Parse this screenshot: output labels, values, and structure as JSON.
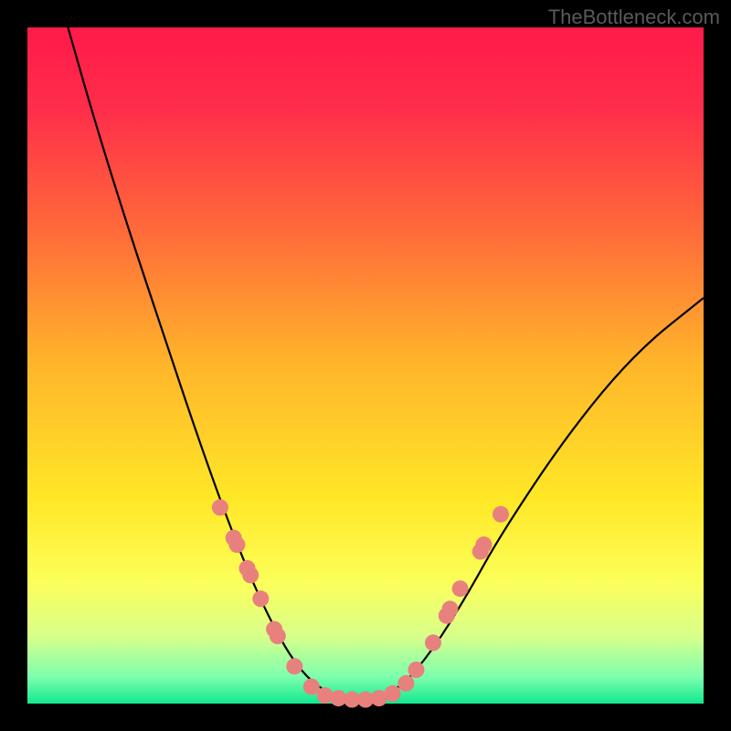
{
  "watermark": "TheBottleneck.com",
  "chart_data": {
    "type": "line",
    "title": "",
    "xlabel": "",
    "ylabel": "",
    "xlim": [
      0,
      100
    ],
    "ylim": [
      0,
      100
    ],
    "background": {
      "type": "vertical-gradient",
      "stops": [
        {
          "pct": 0,
          "color": "#ff1a4a"
        },
        {
          "pct": 12,
          "color": "#ff2d4a"
        },
        {
          "pct": 30,
          "color": "#ff6a3a"
        },
        {
          "pct": 50,
          "color": "#ffb62a"
        },
        {
          "pct": 70,
          "color": "#ffe827"
        },
        {
          "pct": 82,
          "color": "#fcff5a"
        },
        {
          "pct": 90,
          "color": "#d8ff8a"
        },
        {
          "pct": 96,
          "color": "#7effae"
        },
        {
          "pct": 100,
          "color": "#12e88f"
        }
      ]
    },
    "series": [
      {
        "name": "bottleneck-curve",
        "type": "curve",
        "stroke": "#000000",
        "points": [
          {
            "x": 6,
            "y": 100
          },
          {
            "x": 10,
            "y": 86
          },
          {
            "x": 15,
            "y": 70
          },
          {
            "x": 20,
            "y": 55
          },
          {
            "x": 25,
            "y": 40
          },
          {
            "x": 30,
            "y": 26
          },
          {
            "x": 35,
            "y": 14
          },
          {
            "x": 40,
            "y": 5
          },
          {
            "x": 45,
            "y": 1
          },
          {
            "x": 50,
            "y": 0.5
          },
          {
            "x": 55,
            "y": 2
          },
          {
            "x": 60,
            "y": 8
          },
          {
            "x": 65,
            "y": 16
          },
          {
            "x": 70,
            "y": 25
          },
          {
            "x": 80,
            "y": 40
          },
          {
            "x": 90,
            "y": 52
          },
          {
            "x": 100,
            "y": 60
          }
        ]
      },
      {
        "name": "dots-left",
        "type": "scatter",
        "fill": "#e8807e",
        "points": [
          {
            "x": 28.5,
            "y": 29
          },
          {
            "x": 30.5,
            "y": 24.5
          },
          {
            "x": 31,
            "y": 23.5
          },
          {
            "x": 32.5,
            "y": 20
          },
          {
            "x": 33,
            "y": 19
          },
          {
            "x": 34.5,
            "y": 15.5
          },
          {
            "x": 36.5,
            "y": 11
          },
          {
            "x": 37,
            "y": 10
          },
          {
            "x": 39.5,
            "y": 5.5
          },
          {
            "x": 42,
            "y": 2.5
          },
          {
            "x": 44,
            "y": 1.2
          },
          {
            "x": 46,
            "y": 0.8
          },
          {
            "x": 48,
            "y": 0.6
          },
          {
            "x": 50,
            "y": 0.6
          }
        ]
      },
      {
        "name": "dots-right",
        "type": "scatter",
        "fill": "#e8807e",
        "points": [
          {
            "x": 52,
            "y": 0.8
          },
          {
            "x": 54,
            "y": 1.5
          },
          {
            "x": 56,
            "y": 3
          },
          {
            "x": 57.5,
            "y": 5
          },
          {
            "x": 60,
            "y": 9
          },
          {
            "x": 62,
            "y": 13
          },
          {
            "x": 62.5,
            "y": 14
          },
          {
            "x": 64,
            "y": 17
          },
          {
            "x": 67,
            "y": 22.5
          },
          {
            "x": 67.5,
            "y": 23.5
          },
          {
            "x": 70,
            "y": 28
          }
        ]
      }
    ]
  }
}
